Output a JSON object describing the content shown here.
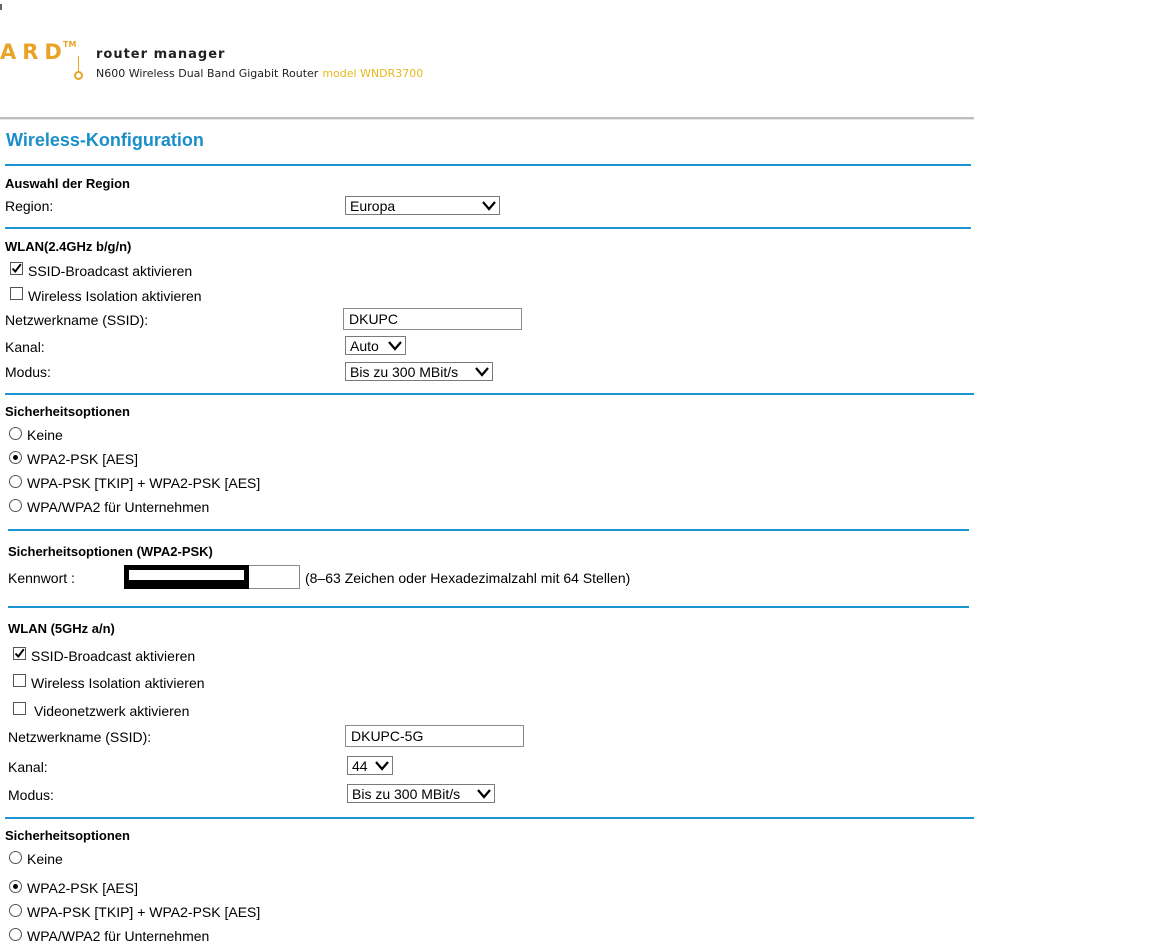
{
  "header": {
    "logo_text": "ARD",
    "logo_tm": "TM",
    "title": "router manager",
    "subtitle": "N600 Wireless Dual Band Gigabit Router",
    "model": "model WNDR3700"
  },
  "page_title": "Wireless-Konfiguration",
  "region": {
    "heading": "Auswahl der Region",
    "label": "Region:",
    "value": "Europa"
  },
  "wlan24": {
    "heading": "WLAN(2.4GHz b/g/n)",
    "ssid_broadcast": "SSID-Broadcast aktivieren",
    "ssid_broadcast_checked": true,
    "isolation": "Wireless Isolation aktivieren",
    "isolation_checked": false,
    "ssid_label": "Netzwerkname (SSID):",
    "ssid_value": "DKUPC",
    "channel_label": "Kanal:",
    "channel_value": "Auto",
    "mode_label": "Modus:",
    "mode_value": "Bis zu 300 MBit/s"
  },
  "security24": {
    "heading": "Sicherheitsoptionen",
    "options": [
      "Keine",
      "WPA2-PSK [AES]",
      "WPA-PSK [TKIP] + WPA2-PSK [AES]",
      "WPA/WPA2 für Unternehmen"
    ],
    "selected": "WPA2-PSK [AES]"
  },
  "psk24": {
    "heading": "Sicherheitsoptionen (WPA2-PSK)",
    "password_label": "Kennwort :",
    "hint": "(8–63 Zeichen oder Hexadezimalzahl mit 64 Stellen)"
  },
  "wlan5": {
    "heading": "WLAN (5GHz a/n)",
    "ssid_broadcast": "SSID-Broadcast aktivieren",
    "ssid_broadcast_checked": true,
    "isolation": "Wireless Isolation aktivieren",
    "isolation_checked": false,
    "video": "Videonetzwerk aktivieren",
    "video_checked": false,
    "ssid_label": "Netzwerkname (SSID):",
    "ssid_value": "DKUPC-5G",
    "channel_label": "Kanal:",
    "channel_value": "44",
    "mode_label": "Modus:",
    "mode_value": "Bis zu 300 MBit/s"
  },
  "security5": {
    "heading": "Sicherheitsoptionen",
    "options": [
      "Keine",
      "WPA2-PSK [AES]",
      "WPA-PSK [TKIP] + WPA2-PSK [AES]",
      "WPA/WPA2 für Unternehmen"
    ],
    "selected": "WPA2-PSK [AES]"
  },
  "colors": {
    "accent": "#1b94cf",
    "title": "#1b8fc9",
    "logo": "#e8a426",
    "model": "#e8b81c"
  }
}
